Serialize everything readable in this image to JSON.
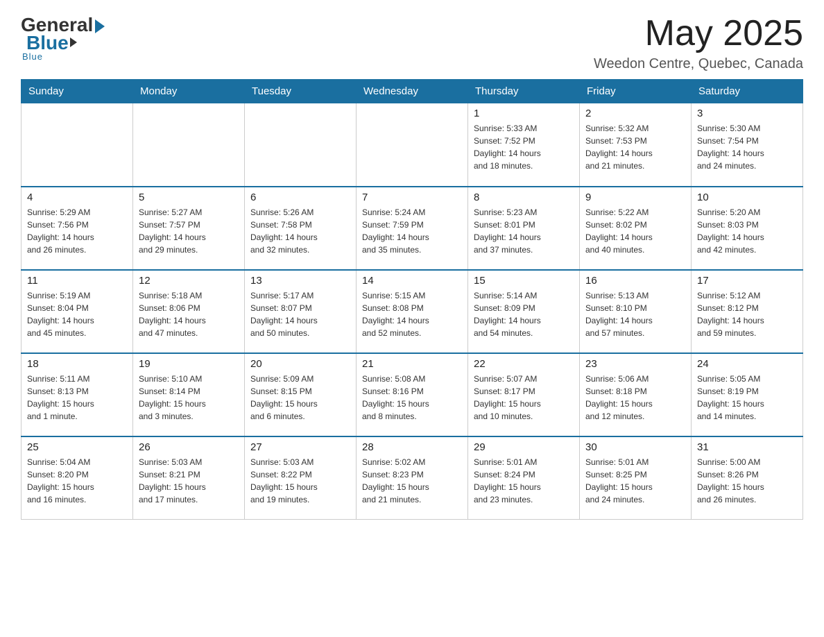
{
  "header": {
    "logo_general": "General",
    "logo_blue": "Blue",
    "month_title": "May 2025",
    "location": "Weedon Centre, Quebec, Canada"
  },
  "days_of_week": [
    "Sunday",
    "Monday",
    "Tuesday",
    "Wednesday",
    "Thursday",
    "Friday",
    "Saturday"
  ],
  "weeks": [
    [
      {
        "day": "",
        "info": ""
      },
      {
        "day": "",
        "info": ""
      },
      {
        "day": "",
        "info": ""
      },
      {
        "day": "",
        "info": ""
      },
      {
        "day": "1",
        "info": "Sunrise: 5:33 AM\nSunset: 7:52 PM\nDaylight: 14 hours\nand 18 minutes."
      },
      {
        "day": "2",
        "info": "Sunrise: 5:32 AM\nSunset: 7:53 PM\nDaylight: 14 hours\nand 21 minutes."
      },
      {
        "day": "3",
        "info": "Sunrise: 5:30 AM\nSunset: 7:54 PM\nDaylight: 14 hours\nand 24 minutes."
      }
    ],
    [
      {
        "day": "4",
        "info": "Sunrise: 5:29 AM\nSunset: 7:56 PM\nDaylight: 14 hours\nand 26 minutes."
      },
      {
        "day": "5",
        "info": "Sunrise: 5:27 AM\nSunset: 7:57 PM\nDaylight: 14 hours\nand 29 minutes."
      },
      {
        "day": "6",
        "info": "Sunrise: 5:26 AM\nSunset: 7:58 PM\nDaylight: 14 hours\nand 32 minutes."
      },
      {
        "day": "7",
        "info": "Sunrise: 5:24 AM\nSunset: 7:59 PM\nDaylight: 14 hours\nand 35 minutes."
      },
      {
        "day": "8",
        "info": "Sunrise: 5:23 AM\nSunset: 8:01 PM\nDaylight: 14 hours\nand 37 minutes."
      },
      {
        "day": "9",
        "info": "Sunrise: 5:22 AM\nSunset: 8:02 PM\nDaylight: 14 hours\nand 40 minutes."
      },
      {
        "day": "10",
        "info": "Sunrise: 5:20 AM\nSunset: 8:03 PM\nDaylight: 14 hours\nand 42 minutes."
      }
    ],
    [
      {
        "day": "11",
        "info": "Sunrise: 5:19 AM\nSunset: 8:04 PM\nDaylight: 14 hours\nand 45 minutes."
      },
      {
        "day": "12",
        "info": "Sunrise: 5:18 AM\nSunset: 8:06 PM\nDaylight: 14 hours\nand 47 minutes."
      },
      {
        "day": "13",
        "info": "Sunrise: 5:17 AM\nSunset: 8:07 PM\nDaylight: 14 hours\nand 50 minutes."
      },
      {
        "day": "14",
        "info": "Sunrise: 5:15 AM\nSunset: 8:08 PM\nDaylight: 14 hours\nand 52 minutes."
      },
      {
        "day": "15",
        "info": "Sunrise: 5:14 AM\nSunset: 8:09 PM\nDaylight: 14 hours\nand 54 minutes."
      },
      {
        "day": "16",
        "info": "Sunrise: 5:13 AM\nSunset: 8:10 PM\nDaylight: 14 hours\nand 57 minutes."
      },
      {
        "day": "17",
        "info": "Sunrise: 5:12 AM\nSunset: 8:12 PM\nDaylight: 14 hours\nand 59 minutes."
      }
    ],
    [
      {
        "day": "18",
        "info": "Sunrise: 5:11 AM\nSunset: 8:13 PM\nDaylight: 15 hours\nand 1 minute."
      },
      {
        "day": "19",
        "info": "Sunrise: 5:10 AM\nSunset: 8:14 PM\nDaylight: 15 hours\nand 3 minutes."
      },
      {
        "day": "20",
        "info": "Sunrise: 5:09 AM\nSunset: 8:15 PM\nDaylight: 15 hours\nand 6 minutes."
      },
      {
        "day": "21",
        "info": "Sunrise: 5:08 AM\nSunset: 8:16 PM\nDaylight: 15 hours\nand 8 minutes."
      },
      {
        "day": "22",
        "info": "Sunrise: 5:07 AM\nSunset: 8:17 PM\nDaylight: 15 hours\nand 10 minutes."
      },
      {
        "day": "23",
        "info": "Sunrise: 5:06 AM\nSunset: 8:18 PM\nDaylight: 15 hours\nand 12 minutes."
      },
      {
        "day": "24",
        "info": "Sunrise: 5:05 AM\nSunset: 8:19 PM\nDaylight: 15 hours\nand 14 minutes."
      }
    ],
    [
      {
        "day": "25",
        "info": "Sunrise: 5:04 AM\nSunset: 8:20 PM\nDaylight: 15 hours\nand 16 minutes."
      },
      {
        "day": "26",
        "info": "Sunrise: 5:03 AM\nSunset: 8:21 PM\nDaylight: 15 hours\nand 17 minutes."
      },
      {
        "day": "27",
        "info": "Sunrise: 5:03 AM\nSunset: 8:22 PM\nDaylight: 15 hours\nand 19 minutes."
      },
      {
        "day": "28",
        "info": "Sunrise: 5:02 AM\nSunset: 8:23 PM\nDaylight: 15 hours\nand 21 minutes."
      },
      {
        "day": "29",
        "info": "Sunrise: 5:01 AM\nSunset: 8:24 PM\nDaylight: 15 hours\nand 23 minutes."
      },
      {
        "day": "30",
        "info": "Sunrise: 5:01 AM\nSunset: 8:25 PM\nDaylight: 15 hours\nand 24 minutes."
      },
      {
        "day": "31",
        "info": "Sunrise: 5:00 AM\nSunset: 8:26 PM\nDaylight: 15 hours\nand 26 minutes."
      }
    ]
  ]
}
